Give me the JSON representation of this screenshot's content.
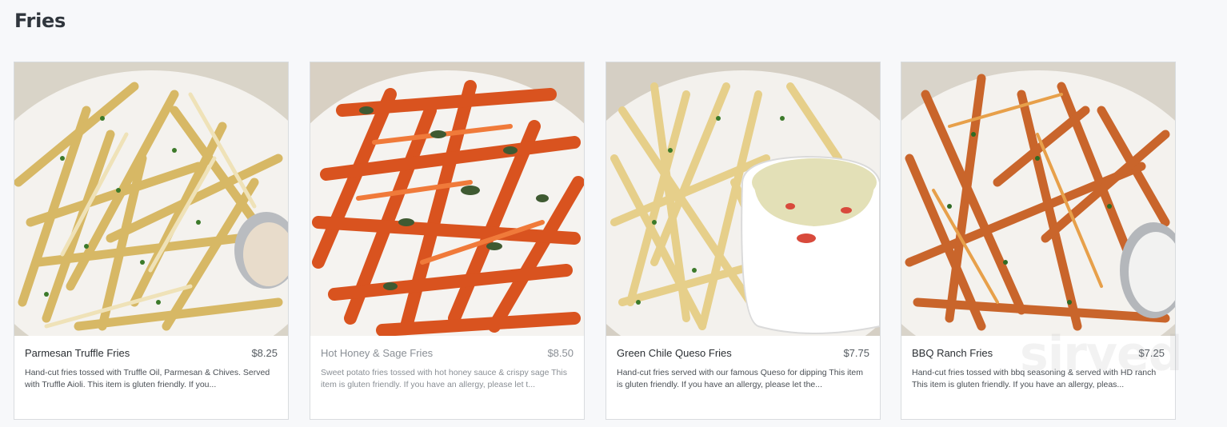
{
  "section": {
    "title": "Fries"
  },
  "watermark": "sirved",
  "items": [
    {
      "name": "Parmesan Truffle Fries",
      "price": "$8.25",
      "description": "Hand-cut fries tossed with Truffle Oil, Parmesan & Chives. Served with Truffle Aioli. This item is gluten friendly. If you...",
      "image_alt": "Parmesan truffle fries with aioli"
    },
    {
      "name": "Hot Honey & Sage Fries",
      "price": "$8.50",
      "description": "Sweet potato fries tossed with hot honey sauce & crispy sage This item is gluten friendly. If you have an allergy, please let t...",
      "image_alt": "Sweet potato fries with sage"
    },
    {
      "name": "Green Chile Queso Fries",
      "price": "$7.75",
      "description": "Hand-cut fries served with our famous Queso for dipping This item is gluten friendly. If you have an allergy, please let the...",
      "image_alt": "Fries with queso cup"
    },
    {
      "name": "BBQ Ranch Fries",
      "price": "$7.25",
      "description": "Hand-cut fries tossed with bbq seasoning & served with HD ranch This item is gluten friendly. If you have an allergy, pleas...",
      "image_alt": "BBQ seasoned fries with ranch"
    }
  ]
}
